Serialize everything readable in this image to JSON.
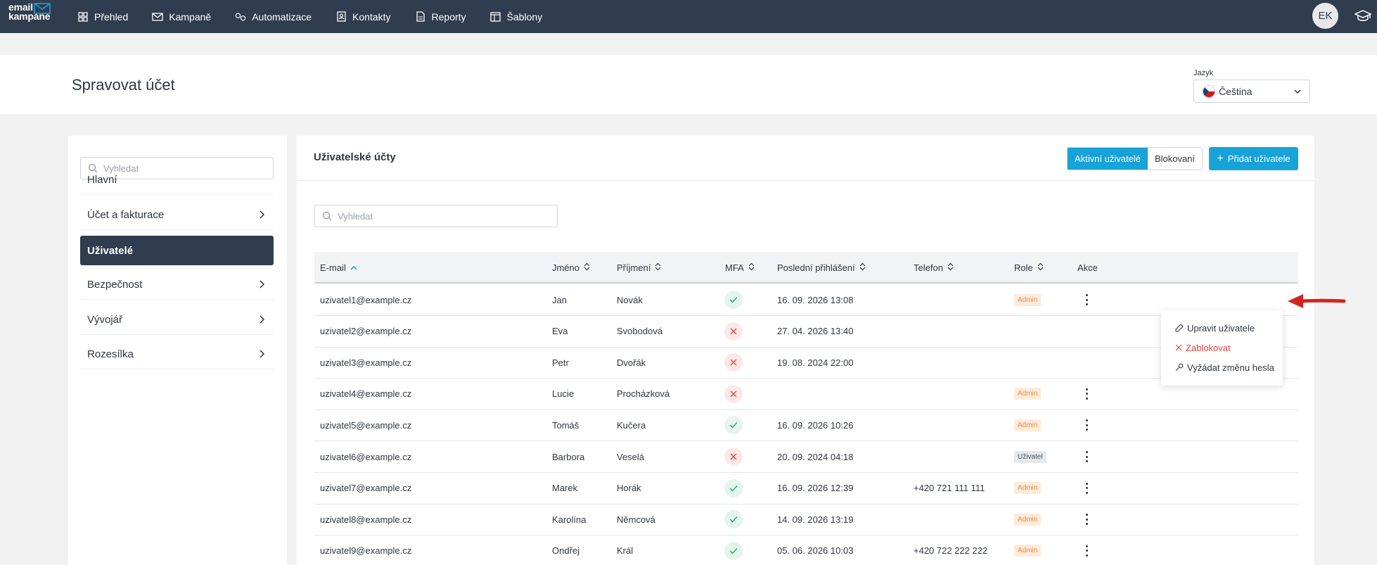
{
  "app": {
    "logo_line1": "email",
    "logo_line2": "kampane",
    "user_initials": "EK"
  },
  "nav": {
    "items": [
      {
        "label": "Přehled",
        "icon": "grid-icon"
      },
      {
        "label": "Kampaně",
        "icon": "mail-icon"
      },
      {
        "label": "Automatizace",
        "icon": "automation-icon"
      },
      {
        "label": "Kontakty",
        "icon": "contacts-icon"
      },
      {
        "label": "Reporty",
        "icon": "report-icon"
      },
      {
        "label": "Šablony",
        "icon": "template-icon"
      }
    ]
  },
  "header": {
    "title": "Spravovat účet",
    "language_label": "Jazyk",
    "language_value": "Čeština"
  },
  "sidebar": {
    "search_placeholder": "Vyhledat",
    "items": [
      {
        "label": "Hlavní",
        "has_arrow": false,
        "active": false
      },
      {
        "label": "Účet a fakturace",
        "has_arrow": true,
        "active": false
      },
      {
        "label": "Uživatelé",
        "has_arrow": false,
        "active": true
      },
      {
        "label": "Bezpečnost",
        "has_arrow": true,
        "active": false
      },
      {
        "label": "Vývojář",
        "has_arrow": true,
        "active": false
      },
      {
        "label": "Rozesílka",
        "has_arrow": true,
        "active": false
      }
    ]
  },
  "main": {
    "title": "Uživatelské účty",
    "filter_active": "Aktivní uživatelé",
    "filter_blocked": "Blokovaní",
    "add_user": "Přidat uživatele",
    "search_placeholder": "Vyhledat",
    "columns": {
      "email": "E-mail",
      "first_name": "Jméno",
      "last_name": "Příjmení",
      "mfa": "MFA",
      "last_login": "Poslední přihlášení",
      "phone": "Telefon",
      "role": "Role",
      "actions": "Akce"
    },
    "rows": [
      {
        "email": "uzivatel1@example.cz",
        "first_name": "Jan",
        "last_name": "Novák",
        "mfa": true,
        "last_login": "16. 09. 2026 13:08",
        "phone": "",
        "role": "Admin"
      },
      {
        "email": "uzivatel2@example.cz",
        "first_name": "Eva",
        "last_name": "Svobodová",
        "mfa": false,
        "last_login": "27. 04. 2026 13:40",
        "phone": "",
        "role": ""
      },
      {
        "email": "uzivatel3@example.cz",
        "first_name": "Petr",
        "last_name": "Dvořák",
        "mfa": false,
        "last_login": "19. 08. 2024 22:00",
        "phone": "",
        "role": ""
      },
      {
        "email": "uzivatel4@example.cz",
        "first_name": "Lucie",
        "last_name": "Procházková",
        "mfa": false,
        "last_login": "",
        "phone": "",
        "role": "Admin"
      },
      {
        "email": "uzivatel5@example.cz",
        "first_name": "Tomáš",
        "last_name": "Kučera",
        "mfa": true,
        "last_login": "16. 09. 2026 10:26",
        "phone": "",
        "role": "Admin"
      },
      {
        "email": "uzivatel6@example.cz",
        "first_name": "Barbora",
        "last_name": "Veselá",
        "mfa": false,
        "last_login": "20. 09. 2024 04:18",
        "phone": "",
        "role": "Uživatel"
      },
      {
        "email": "uzivatel7@example.cz",
        "first_name": "Marek",
        "last_name": "Horák",
        "mfa": true,
        "last_login": "16. 09. 2026 12:39",
        "phone": "+420 721 111 111",
        "role": "Admin"
      },
      {
        "email": "uzivatel8@example.cz",
        "first_name": "Karolína",
        "last_name": "Němcová",
        "mfa": true,
        "last_login": "14. 09. 2026 13:19",
        "phone": "",
        "role": "Admin"
      },
      {
        "email": "uzivatel9@example.cz",
        "first_name": "Ondřej",
        "last_name": "Král",
        "mfa": true,
        "last_login": "05. 06. 2026 10:03",
        "phone": "+420 722 222 222",
        "role": "Admin"
      }
    ]
  },
  "menu": {
    "edit": "Upravit uživatele",
    "block": "Zablokovat",
    "reset": "Vyžádat změnu hesla"
  },
  "colors": {
    "nav_bg": "#2f3d4e",
    "accent": "#17a2d8",
    "danger": "#e8453c",
    "admin_badge": "#f08a3c"
  }
}
